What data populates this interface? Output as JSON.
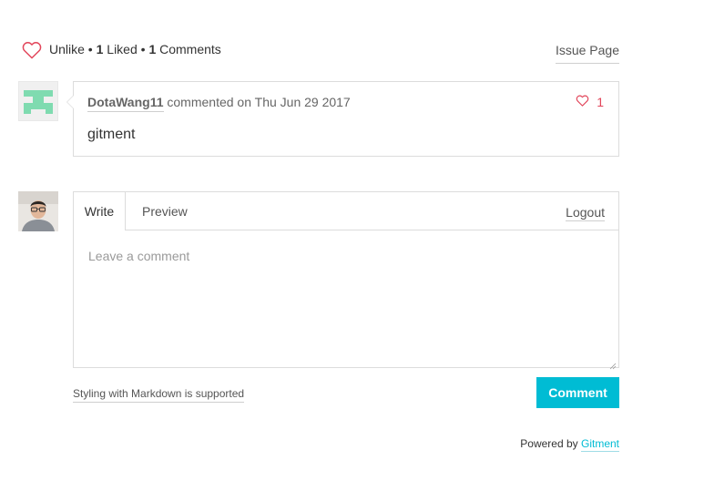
{
  "header": {
    "like_icon": "heart-outline-icon",
    "unlike_label": "Unlike",
    "separator": "•",
    "liked_count": "1",
    "liked_label": "Liked",
    "comments_count": "1",
    "comments_label": "Comments",
    "issue_page_label": "Issue Page"
  },
  "comment": {
    "author": "DotaWang11",
    "action": "commented on",
    "date": "Thu Jun 29 2017",
    "likes": "1",
    "body": "gitment",
    "avatar_color": "#7fdbb0"
  },
  "editor": {
    "tabs": [
      {
        "label": "Write",
        "active": true
      },
      {
        "label": "Preview",
        "active": false
      }
    ],
    "logout_label": "Logout",
    "placeholder": "Leave a comment",
    "value": ""
  },
  "footer": {
    "markdown_label": "Styling with Markdown is supported",
    "comment_button_label": "Comment",
    "powered_by_label": "Powered by",
    "gitment_label": "Gitment"
  },
  "colors": {
    "accent": "#00bcd4",
    "heart": "#e2455a",
    "border": "#dcdcdc"
  }
}
